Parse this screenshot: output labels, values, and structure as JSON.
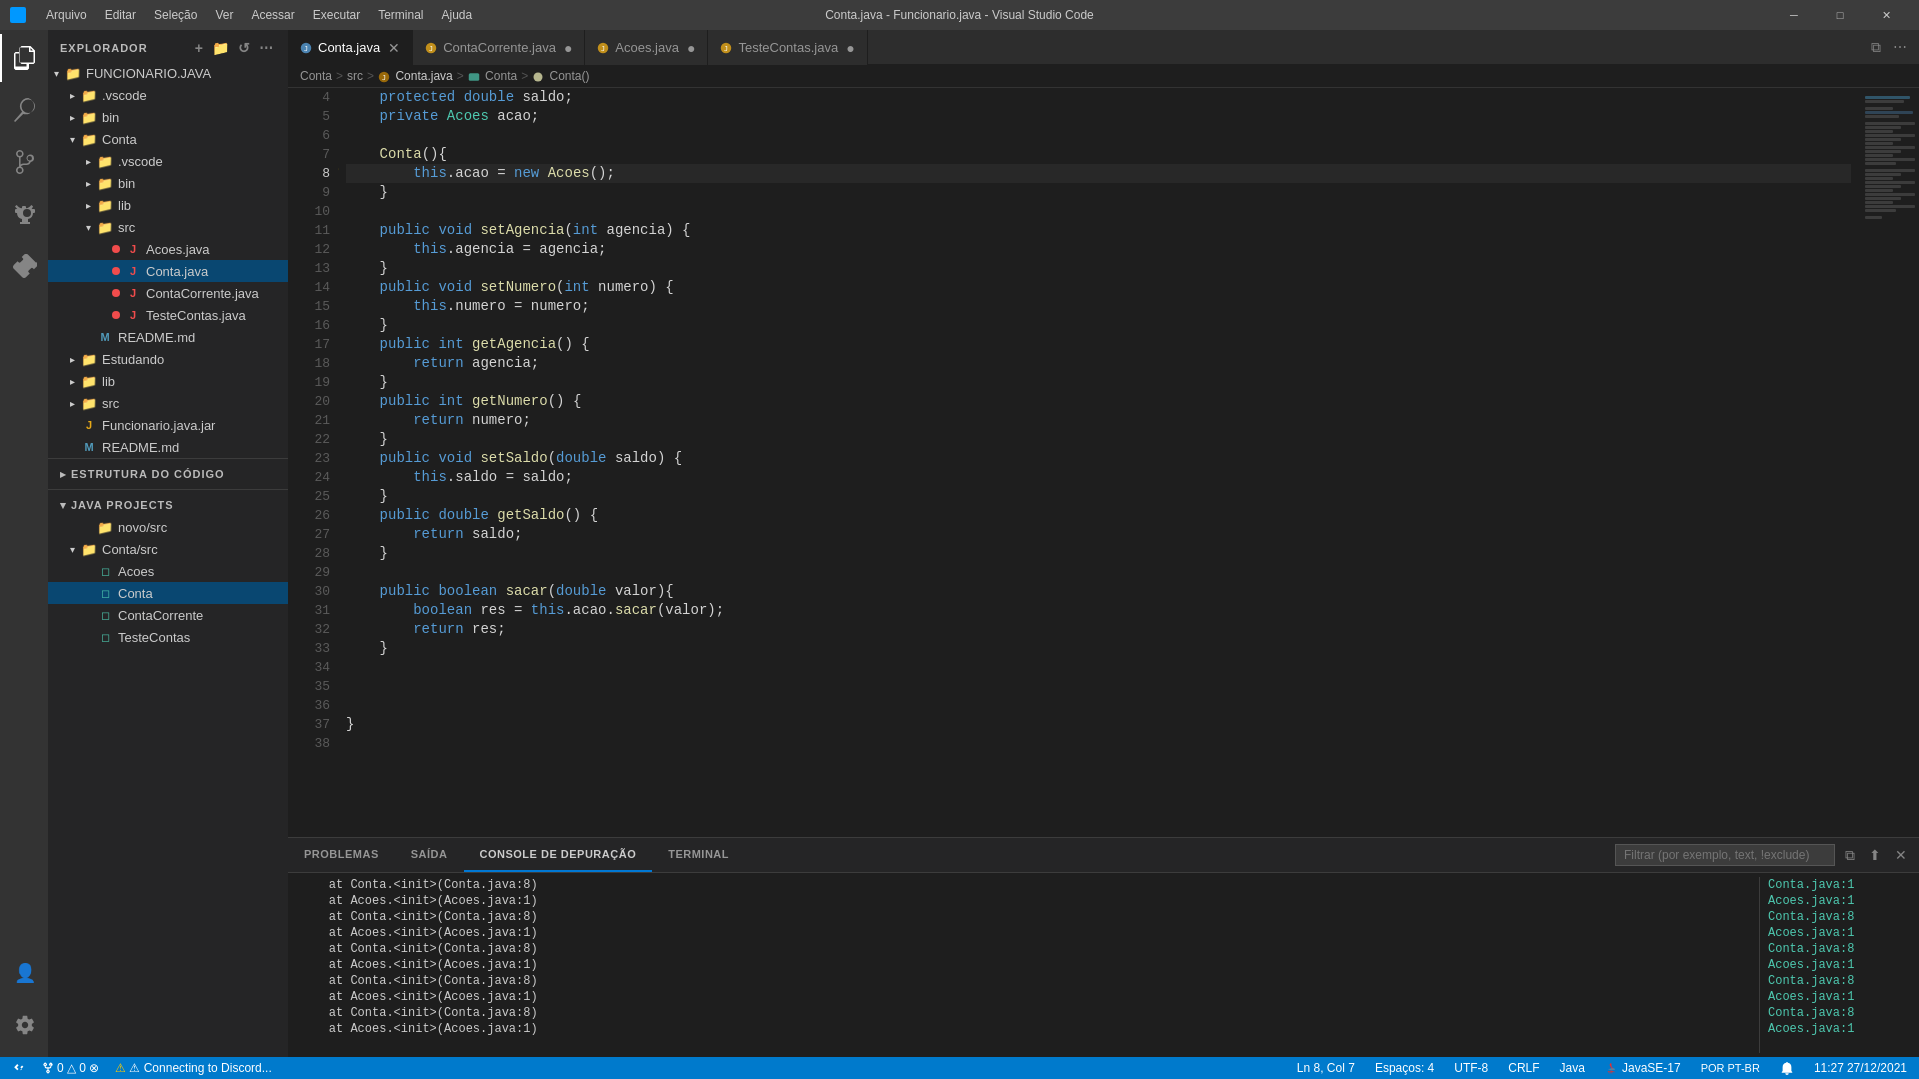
{
  "titleBar": {
    "title": "Conta.java - Funcionario.java - Visual Studio Code",
    "menus": [
      "Arquivo",
      "Editar",
      "Seleção",
      "Ver",
      "Acessar",
      "Executar",
      "Terminal",
      "Ajuda"
    ]
  },
  "activityBar": {
    "icons": [
      {
        "name": "explorer-icon",
        "symbol": "⎘",
        "active": true
      },
      {
        "name": "search-icon",
        "symbol": "🔍",
        "active": false
      },
      {
        "name": "source-control-icon",
        "symbol": "⎇",
        "active": false
      },
      {
        "name": "debug-icon",
        "symbol": "▷",
        "active": false
      },
      {
        "name": "extensions-icon",
        "symbol": "⊞",
        "active": false
      }
    ],
    "bottomIcons": [
      {
        "name": "accounts-icon",
        "symbol": "👤"
      },
      {
        "name": "settings-icon",
        "symbol": "⚙"
      }
    ]
  },
  "sidebar": {
    "explorerTitle": "EXPLORADOR",
    "explorerActions": [
      "...",
      ""
    ],
    "tree": [
      {
        "label": "FUNCIONARIO.JAVA",
        "indent": 0,
        "arrow": "▾",
        "icon": "",
        "type": "folder",
        "expanded": true
      },
      {
        "label": ".vscode",
        "indent": 1,
        "arrow": "▸",
        "icon": "",
        "type": "folder"
      },
      {
        "label": "bin",
        "indent": 1,
        "arrow": "▸",
        "icon": "",
        "type": "folder"
      },
      {
        "label": "Conta",
        "indent": 1,
        "arrow": "▾",
        "icon": "",
        "type": "folder",
        "expanded": true
      },
      {
        "label": ".vscode",
        "indent": 2,
        "arrow": "▸",
        "icon": "",
        "type": "folder"
      },
      {
        "label": "bin",
        "indent": 2,
        "arrow": "▸",
        "icon": "",
        "type": "folder"
      },
      {
        "label": "lib",
        "indent": 2,
        "arrow": "▸",
        "icon": "",
        "type": "folder"
      },
      {
        "label": "src",
        "indent": 2,
        "arrow": "▾",
        "icon": "",
        "type": "folder",
        "expanded": true
      },
      {
        "label": "Acoes.java",
        "indent": 3,
        "icon": "J",
        "type": "file",
        "dot": "red"
      },
      {
        "label": "Conta.java",
        "indent": 3,
        "icon": "J",
        "type": "file",
        "dot": "red",
        "selected": true
      },
      {
        "label": "ContaCorrente.java",
        "indent": 3,
        "icon": "J",
        "type": "file",
        "dot": "red"
      },
      {
        "label": "TesteContas.java",
        "indent": 3,
        "icon": "J",
        "type": "file",
        "dot": "red"
      },
      {
        "label": "README.md",
        "indent": 2,
        "icon": "M",
        "type": "file"
      },
      {
        "label": "Estudando",
        "indent": 1,
        "arrow": "▸",
        "icon": "",
        "type": "folder"
      },
      {
        "label": "lib",
        "indent": 1,
        "arrow": "▸",
        "icon": "",
        "type": "folder"
      },
      {
        "label": "src",
        "indent": 1,
        "arrow": "▸",
        "icon": "",
        "type": "folder"
      },
      {
        "label": "Funcionario.java.jar",
        "indent": 1,
        "icon": "J",
        "type": "file"
      },
      {
        "label": "README.md",
        "indent": 1,
        "icon": "M",
        "type": "file"
      }
    ],
    "estruturaTitle": "ESTRUTURA DO CÓDIGO",
    "javaProjectsTitle": "JAVA PROJECTS",
    "javaTree": [
      {
        "label": "novo/src",
        "indent": 2,
        "type": "folder"
      },
      {
        "label": "Conta/src",
        "indent": 1,
        "type": "folder",
        "expanded": true
      },
      {
        "label": "Acoes",
        "indent": 2,
        "type": "class"
      },
      {
        "label": "Conta",
        "indent": 2,
        "type": "class",
        "selected": true
      },
      {
        "label": "ContaCorrente",
        "indent": 2,
        "type": "class"
      },
      {
        "label": "TesteContas",
        "indent": 2,
        "type": "class"
      }
    ]
  },
  "tabs": [
    {
      "label": "Conta.java",
      "active": true,
      "dot": "none",
      "modified": false,
      "dotColor": ""
    },
    {
      "label": "ContaCorrente.java",
      "active": false,
      "dot": "orange",
      "modified": true
    },
    {
      "label": "Acoes.java",
      "active": false,
      "dot": "orange",
      "modified": true
    },
    {
      "label": "TesteContas.java",
      "active": false,
      "dot": "orange",
      "modified": true
    }
  ],
  "breadcrumb": [
    "Conta",
    ">",
    "src",
    ">",
    "Conta.java",
    ">",
    "Conta",
    ">",
    "Conta()"
  ],
  "code": {
    "lines": [
      {
        "num": 4,
        "content": "    protected double saldo;",
        "tokens": [
          {
            "t": "kw",
            "v": "    protected "
          },
          {
            "t": "kw",
            "v": "double"
          },
          {
            "t": "plain",
            "v": " saldo;"
          }
        ]
      },
      {
        "num": 5,
        "content": "    private Acoes acao;",
        "tokens": [
          {
            "t": "kw",
            "v": "    private "
          },
          {
            "t": "type",
            "v": "Acoes"
          },
          {
            "t": "plain",
            "v": " acao;"
          }
        ]
      },
      {
        "num": 6,
        "content": "",
        "tokens": []
      },
      {
        "num": 7,
        "content": "    Conta(){",
        "tokens": [
          {
            "t": "plain",
            "v": "    "
          },
          {
            "t": "func",
            "v": "Conta"
          },
          {
            "t": "plain",
            "v": "(){"
          }
        ]
      },
      {
        "num": 8,
        "content": "        this.acao = new Acoes();",
        "tokens": [
          {
            "t": "plain",
            "v": "        "
          },
          {
            "t": "kw",
            "v": "this"
          },
          {
            "t": "plain",
            "v": ".acao = "
          },
          {
            "t": "kw",
            "v": "new"
          },
          {
            "t": "plain",
            "v": " "
          },
          {
            "t": "func",
            "v": "Acoes"
          },
          {
            "t": "plain",
            "v": "();"
          }
        ],
        "hasLightbulb": true,
        "current": true
      },
      {
        "num": 9,
        "content": "    }",
        "tokens": [
          {
            "t": "plain",
            "v": "    }"
          }
        ]
      },
      {
        "num": 10,
        "content": "",
        "tokens": []
      },
      {
        "num": 11,
        "content": "    public void setAgencia(int agencia) {",
        "tokens": [
          {
            "t": "kw",
            "v": "    public "
          },
          {
            "t": "kw",
            "v": "void"
          },
          {
            "t": "plain",
            "v": " "
          },
          {
            "t": "func",
            "v": "setAgencia"
          },
          {
            "t": "plain",
            "v": "("
          },
          {
            "t": "kw",
            "v": "int"
          },
          {
            "t": "plain",
            "v": " agencia) {"
          }
        ]
      },
      {
        "num": 12,
        "content": "        this.agencia = agencia;",
        "tokens": [
          {
            "t": "plain",
            "v": "        "
          },
          {
            "t": "kw",
            "v": "this"
          },
          {
            "t": "plain",
            "v": ".agencia = agencia;"
          }
        ]
      },
      {
        "num": 13,
        "content": "    }",
        "tokens": [
          {
            "t": "plain",
            "v": "    }"
          }
        ]
      },
      {
        "num": 14,
        "content": "    public void setNumero(int numero) {",
        "tokens": [
          {
            "t": "kw",
            "v": "    public "
          },
          {
            "t": "kw",
            "v": "void"
          },
          {
            "t": "plain",
            "v": " "
          },
          {
            "t": "func",
            "v": "setNumero"
          },
          {
            "t": "plain",
            "v": "("
          },
          {
            "t": "kw",
            "v": "int"
          },
          {
            "t": "plain",
            "v": " numero) {"
          }
        ]
      },
      {
        "num": 15,
        "content": "        this.numero = numero;",
        "tokens": [
          {
            "t": "plain",
            "v": "        "
          },
          {
            "t": "kw",
            "v": "this"
          },
          {
            "t": "plain",
            "v": ".numero = numero;"
          }
        ]
      },
      {
        "num": 16,
        "content": "    }",
        "tokens": [
          {
            "t": "plain",
            "v": "    }"
          }
        ]
      },
      {
        "num": 17,
        "content": "    public int getAgencia() {",
        "tokens": [
          {
            "t": "kw",
            "v": "    public "
          },
          {
            "t": "kw",
            "v": "int"
          },
          {
            "t": "plain",
            "v": " "
          },
          {
            "t": "func",
            "v": "getAgencia"
          },
          {
            "t": "plain",
            "v": "() {"
          }
        ]
      },
      {
        "num": 18,
        "content": "        return agencia;",
        "tokens": [
          {
            "t": "plain",
            "v": "        "
          },
          {
            "t": "kw",
            "v": "return"
          },
          {
            "t": "plain",
            "v": " agencia;"
          }
        ]
      },
      {
        "num": 19,
        "content": "    }",
        "tokens": [
          {
            "t": "plain",
            "v": "    }"
          }
        ]
      },
      {
        "num": 20,
        "content": "    public int getNumero() {",
        "tokens": [
          {
            "t": "kw",
            "v": "    public "
          },
          {
            "t": "kw",
            "v": "int"
          },
          {
            "t": "plain",
            "v": " "
          },
          {
            "t": "func",
            "v": "getNumero"
          },
          {
            "t": "plain",
            "v": "() {"
          }
        ]
      },
      {
        "num": 21,
        "content": "        return numero;",
        "tokens": [
          {
            "t": "plain",
            "v": "        "
          },
          {
            "t": "kw",
            "v": "return"
          },
          {
            "t": "plain",
            "v": " numero;"
          }
        ]
      },
      {
        "num": 22,
        "content": "    }",
        "tokens": [
          {
            "t": "plain",
            "v": "    }"
          }
        ]
      },
      {
        "num": 23,
        "content": "    public void setSaldo(double saldo) {",
        "tokens": [
          {
            "t": "kw",
            "v": "    public "
          },
          {
            "t": "kw",
            "v": "void"
          },
          {
            "t": "plain",
            "v": " "
          },
          {
            "t": "func",
            "v": "setSaldo"
          },
          {
            "t": "plain",
            "v": "("
          },
          {
            "t": "kw",
            "v": "double"
          },
          {
            "t": "plain",
            "v": " saldo) {"
          }
        ]
      },
      {
        "num": 24,
        "content": "        this.saldo = saldo;",
        "tokens": [
          {
            "t": "plain",
            "v": "        "
          },
          {
            "t": "kw",
            "v": "this"
          },
          {
            "t": "plain",
            "v": ".saldo = saldo;"
          }
        ]
      },
      {
        "num": 25,
        "content": "    }",
        "tokens": [
          {
            "t": "plain",
            "v": "    }"
          }
        ]
      },
      {
        "num": 26,
        "content": "    public double getSaldo() {",
        "tokens": [
          {
            "t": "kw",
            "v": "    public "
          },
          {
            "t": "kw",
            "v": "double"
          },
          {
            "t": "plain",
            "v": " "
          },
          {
            "t": "func",
            "v": "getSaldo"
          },
          {
            "t": "plain",
            "v": "() {"
          }
        ]
      },
      {
        "num": 27,
        "content": "        return saldo;",
        "tokens": [
          {
            "t": "plain",
            "v": "        "
          },
          {
            "t": "kw",
            "v": "return"
          },
          {
            "t": "plain",
            "v": " saldo;"
          }
        ]
      },
      {
        "num": 28,
        "content": "    }",
        "tokens": [
          {
            "t": "plain",
            "v": "    }"
          }
        ]
      },
      {
        "num": 29,
        "content": "",
        "tokens": []
      },
      {
        "num": 30,
        "content": "    public boolean sacar(double valor){",
        "tokens": [
          {
            "t": "kw",
            "v": "    public "
          },
          {
            "t": "kw",
            "v": "boolean"
          },
          {
            "t": "plain",
            "v": " "
          },
          {
            "t": "func",
            "v": "sacar"
          },
          {
            "t": "plain",
            "v": "("
          },
          {
            "t": "kw",
            "v": "double"
          },
          {
            "t": "plain",
            "v": " valor){"
          }
        ]
      },
      {
        "num": 31,
        "content": "        boolean res = this.acao.sacar(valor);",
        "tokens": [
          {
            "t": "plain",
            "v": "        "
          },
          {
            "t": "kw",
            "v": "boolean"
          },
          {
            "t": "plain",
            "v": " res = "
          },
          {
            "t": "kw",
            "v": "this"
          },
          {
            "t": "plain",
            "v": ".acao."
          },
          {
            "t": "func",
            "v": "sacar"
          },
          {
            "t": "plain",
            "v": "(valor);"
          }
        ]
      },
      {
        "num": 32,
        "content": "        return res;",
        "tokens": [
          {
            "t": "plain",
            "v": "        "
          },
          {
            "t": "kw",
            "v": "return"
          },
          {
            "t": "plain",
            "v": " res;"
          }
        ]
      },
      {
        "num": 33,
        "content": "    }",
        "tokens": [
          {
            "t": "plain",
            "v": "    }"
          }
        ]
      },
      {
        "num": 34,
        "content": "",
        "tokens": []
      },
      {
        "num": 35,
        "content": "",
        "tokens": []
      },
      {
        "num": 36,
        "content": "",
        "tokens": []
      },
      {
        "num": 37,
        "content": "}",
        "tokens": [
          {
            "t": "plain",
            "v": "}"
          }
        ]
      },
      {
        "num": 38,
        "content": "",
        "tokens": []
      }
    ]
  },
  "bottomPanel": {
    "tabs": [
      "PROBLEMAS",
      "SAÍDA",
      "CONSOLE DE DEPURAÇÃO",
      "TERMINAL"
    ],
    "activeTab": "CONSOLE DE DEPURAÇÃO",
    "filterPlaceholder": "Filtrar (por exemplo, text, !exclude)",
    "consoleLines": [
      "    at Conta.<init>(Conta.java:8)",
      "    at Acoes.<init>(Acoes.java:1)",
      "    at Conta.<init>(Conta.java:8)",
      "    at Acoes.<init>(Acoes.java:1)",
      "    at Conta.<init>(Conta.java:8)",
      "    at Acoes.<init>(Acoes.java:1)",
      "    at Conta.<init>(Conta.java:8)",
      "    at Acoes.<init>(Acoes.java:1)",
      "    at Conta.<init>(Conta.java:8)",
      "    at Acoes.<init>(Acoes.java:1)"
    ],
    "consoleRight": [
      "Conta.java:1",
      "Acoes.java:1",
      "Conta.java:8",
      "Acoes.java:1",
      "Conta.java:8",
      "Acoes.java:1",
      "Conta.java:8",
      "Acoes.java:1",
      "Conta.java:8",
      "Acoes.java:1"
    ]
  },
  "statusBar": {
    "left": [
      {
        "label": "⎇ 0 △ 0 ⊗",
        "name": "git-status"
      },
      {
        "label": "⚠ Connecting to Discord...",
        "name": "discord-status"
      }
    ],
    "right": [
      {
        "label": "Ln 8, Col 7",
        "name": "cursor-position"
      },
      {
        "label": "Espaços: 4",
        "name": "indentation"
      },
      {
        "label": "UTF-8",
        "name": "encoding"
      },
      {
        "label": "CRLF",
        "name": "line-ending"
      },
      {
        "label": "Java",
        "name": "language"
      },
      {
        "label": "☕",
        "name": "java-icon"
      },
      {
        "label": "JavaSE-17",
        "name": "java-version"
      },
      {
        "label": "POR PT-BR",
        "name": "locale"
      },
      {
        "label": "11:27",
        "name": "time"
      },
      {
        "label": "27/12/2021",
        "name": "date"
      }
    ]
  }
}
